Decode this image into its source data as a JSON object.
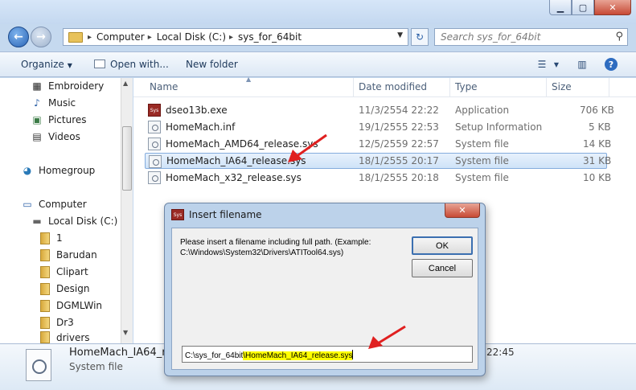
{
  "address_bar": {
    "crumbs": [
      "Computer",
      "Local Disk (C:)",
      "sys_for_64bit"
    ],
    "search_placeholder": "Search sys_for_64bit"
  },
  "toolbar": {
    "organize": "Organize",
    "open_with": "Open with...",
    "new_folder": "New folder"
  },
  "nav_pane": {
    "items": [
      {
        "label": "Embroidery",
        "icon": "embroidery-icon"
      },
      {
        "label": "Music",
        "icon": "music-icon"
      },
      {
        "label": "Pictures",
        "icon": "pictures-icon"
      },
      {
        "label": "Videos",
        "icon": "videos-icon"
      },
      {
        "label": "Homegroup",
        "icon": "homegroup-icon"
      },
      {
        "label": "Computer",
        "icon": "computer-icon"
      },
      {
        "label": "Local Disk (C:)",
        "icon": "drive-icon"
      },
      {
        "label": "1",
        "icon": "folder-icon"
      },
      {
        "label": "Barudan",
        "icon": "folder-icon"
      },
      {
        "label": "Clipart",
        "icon": "folder-icon"
      },
      {
        "label": "Design",
        "icon": "folder-icon"
      },
      {
        "label": "DGMLWin",
        "icon": "folder-icon"
      },
      {
        "label": "Dr3",
        "icon": "folder-icon"
      },
      {
        "label": "drivers",
        "icon": "folder-icon"
      }
    ]
  },
  "file_list": {
    "columns": [
      "Name",
      "Date modified",
      "Type",
      "Size"
    ],
    "rows": [
      {
        "name": "dseo13b.exe",
        "date": "11/3/2554 22:22",
        "type": "Application",
        "size": "706 KB",
        "icon": "exe-icon"
      },
      {
        "name": "HomeMach.inf",
        "date": "19/1/2555 22:53",
        "type": "Setup Information",
        "size": "5 KB",
        "icon": "inf-file-icon"
      },
      {
        "name": "HomeMach_AMD64_release.sys",
        "date": "12/5/2559 22:57",
        "type": "System file",
        "size": "14 KB",
        "icon": "sys-file-icon"
      },
      {
        "name": "HomeMach_IA64_release.sys",
        "date": "18/1/2555 20:17",
        "type": "System file",
        "size": "31 KB",
        "icon": "sys-file-icon"
      },
      {
        "name": "HomeMach_x32_release.sys",
        "date": "18/1/2555 20:18",
        "type": "System file",
        "size": "10 KB",
        "icon": "sys-file-icon"
      }
    ],
    "selected_index": 3
  },
  "details_pane": {
    "name": "HomeMach_IA64_rele",
    "type": "System file",
    "time_fragment": "22:45"
  },
  "dialog": {
    "title": "Insert filename",
    "icon_text": "Sys",
    "prompt": "Please insert a filename including full path. (Example: C:\\Windows\\System32\\Drivers\\ATITool64.sys)",
    "ok": "OK",
    "cancel": "Cancel",
    "input_prefix": "C:\\sys_for_64bit",
    "input_highlight": "\\HomeMach_IA64_release.sys"
  },
  "colors": {
    "annotation_arrow": "#e02020",
    "highlight": "#ffff00",
    "selection": "#cfe3f8"
  }
}
